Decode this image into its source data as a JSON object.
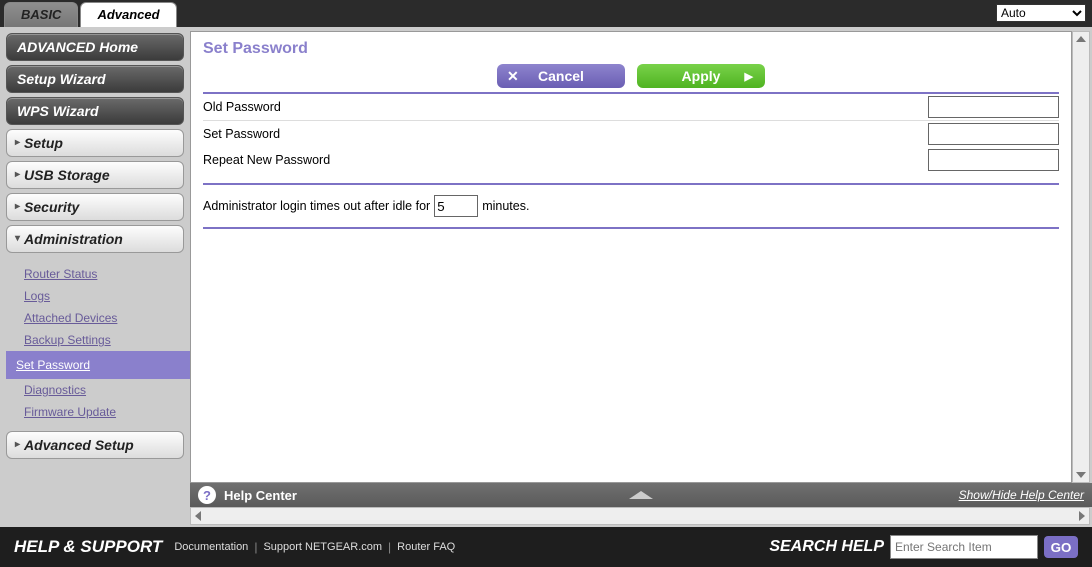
{
  "tabs": {
    "basic": "BASIC",
    "advanced": "Advanced"
  },
  "top_dropdown": {
    "selected": "Auto"
  },
  "sidebar": {
    "home": "ADVANCED Home",
    "setup_wizard": "Setup Wizard",
    "wps_wizard": "WPS Wizard",
    "groups": {
      "setup": "Setup",
      "usb": "USB Storage",
      "security": "Security",
      "admin": "Administration",
      "advanced_setup": "Advanced Setup"
    },
    "admin_items": {
      "router_status": "Router Status",
      "logs": "Logs",
      "attached_devices": "Attached Devices",
      "backup_settings": "Backup Settings",
      "set_password": "Set Password",
      "diagnostics": "Diagnostics",
      "firmware_update": "Firmware Update"
    }
  },
  "page": {
    "title": "Set Password",
    "cancel": "Cancel",
    "apply": "Apply",
    "labels": {
      "old_pw": "Old Password",
      "set_pw": "Set Password",
      "repeat_pw": "Repeat New Password"
    },
    "timeout_pre": "Administrator login times out after idle for",
    "timeout_value": "5",
    "timeout_post": "minutes."
  },
  "help_center": {
    "label": "Help Center",
    "showhide": "Show/Hide Help Center"
  },
  "footer": {
    "title": "HELP & SUPPORT",
    "links": {
      "doc": "Documentation",
      "support": "Support NETGEAR.com",
      "faq": "Router FAQ"
    },
    "search_label": "SEARCH HELP",
    "search_placeholder": "Enter Search Item",
    "go": "GO"
  }
}
